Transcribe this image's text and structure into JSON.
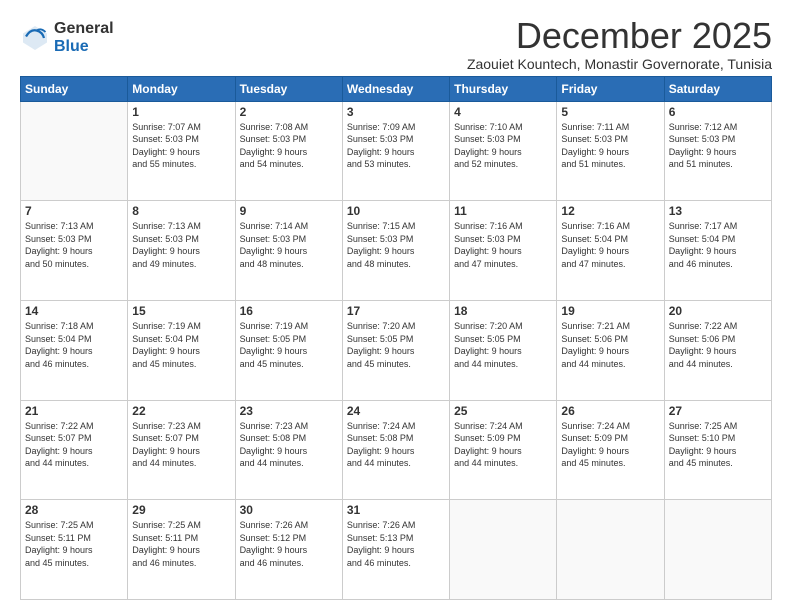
{
  "logo": {
    "general": "General",
    "blue": "Blue"
  },
  "header": {
    "title": "December 2025",
    "subtitle": "Zaouiet Kountech, Monastir Governorate, Tunisia"
  },
  "weekdays": [
    "Sunday",
    "Monday",
    "Tuesday",
    "Wednesday",
    "Thursday",
    "Friday",
    "Saturday"
  ],
  "weeks": [
    [
      {
        "day": "",
        "sunrise": "",
        "sunset": "",
        "daylight": ""
      },
      {
        "day": "1",
        "sunrise": "Sunrise: 7:07 AM",
        "sunset": "Sunset: 5:03 PM",
        "daylight": "Daylight: 9 hours and 55 minutes."
      },
      {
        "day": "2",
        "sunrise": "Sunrise: 7:08 AM",
        "sunset": "Sunset: 5:03 PM",
        "daylight": "Daylight: 9 hours and 54 minutes."
      },
      {
        "day": "3",
        "sunrise": "Sunrise: 7:09 AM",
        "sunset": "Sunset: 5:03 PM",
        "daylight": "Daylight: 9 hours and 53 minutes."
      },
      {
        "day": "4",
        "sunrise": "Sunrise: 7:10 AM",
        "sunset": "Sunset: 5:03 PM",
        "daylight": "Daylight: 9 hours and 52 minutes."
      },
      {
        "day": "5",
        "sunrise": "Sunrise: 7:11 AM",
        "sunset": "Sunset: 5:03 PM",
        "daylight": "Daylight: 9 hours and 51 minutes."
      },
      {
        "day": "6",
        "sunrise": "Sunrise: 7:12 AM",
        "sunset": "Sunset: 5:03 PM",
        "daylight": "Daylight: 9 hours and 51 minutes."
      }
    ],
    [
      {
        "day": "7",
        "sunrise": "Sunrise: 7:13 AM",
        "sunset": "Sunset: 5:03 PM",
        "daylight": "Daylight: 9 hours and 50 minutes."
      },
      {
        "day": "8",
        "sunrise": "Sunrise: 7:13 AM",
        "sunset": "Sunset: 5:03 PM",
        "daylight": "Daylight: 9 hours and 49 minutes."
      },
      {
        "day": "9",
        "sunrise": "Sunrise: 7:14 AM",
        "sunset": "Sunset: 5:03 PM",
        "daylight": "Daylight: 9 hours and 48 minutes."
      },
      {
        "day": "10",
        "sunrise": "Sunrise: 7:15 AM",
        "sunset": "Sunset: 5:03 PM",
        "daylight": "Daylight: 9 hours and 48 minutes."
      },
      {
        "day": "11",
        "sunrise": "Sunrise: 7:16 AM",
        "sunset": "Sunset: 5:03 PM",
        "daylight": "Daylight: 9 hours and 47 minutes."
      },
      {
        "day": "12",
        "sunrise": "Sunrise: 7:16 AM",
        "sunset": "Sunset: 5:04 PM",
        "daylight": "Daylight: 9 hours and 47 minutes."
      },
      {
        "day": "13",
        "sunrise": "Sunrise: 7:17 AM",
        "sunset": "Sunset: 5:04 PM",
        "daylight": "Daylight: 9 hours and 46 minutes."
      }
    ],
    [
      {
        "day": "14",
        "sunrise": "Sunrise: 7:18 AM",
        "sunset": "Sunset: 5:04 PM",
        "daylight": "Daylight: 9 hours and 46 minutes."
      },
      {
        "day": "15",
        "sunrise": "Sunrise: 7:19 AM",
        "sunset": "Sunset: 5:04 PM",
        "daylight": "Daylight: 9 hours and 45 minutes."
      },
      {
        "day": "16",
        "sunrise": "Sunrise: 7:19 AM",
        "sunset": "Sunset: 5:05 PM",
        "daylight": "Daylight: 9 hours and 45 minutes."
      },
      {
        "day": "17",
        "sunrise": "Sunrise: 7:20 AM",
        "sunset": "Sunset: 5:05 PM",
        "daylight": "Daylight: 9 hours and 45 minutes."
      },
      {
        "day": "18",
        "sunrise": "Sunrise: 7:20 AM",
        "sunset": "Sunset: 5:05 PM",
        "daylight": "Daylight: 9 hours and 44 minutes."
      },
      {
        "day": "19",
        "sunrise": "Sunrise: 7:21 AM",
        "sunset": "Sunset: 5:06 PM",
        "daylight": "Daylight: 9 hours and 44 minutes."
      },
      {
        "day": "20",
        "sunrise": "Sunrise: 7:22 AM",
        "sunset": "Sunset: 5:06 PM",
        "daylight": "Daylight: 9 hours and 44 minutes."
      }
    ],
    [
      {
        "day": "21",
        "sunrise": "Sunrise: 7:22 AM",
        "sunset": "Sunset: 5:07 PM",
        "daylight": "Daylight: 9 hours and 44 minutes."
      },
      {
        "day": "22",
        "sunrise": "Sunrise: 7:23 AM",
        "sunset": "Sunset: 5:07 PM",
        "daylight": "Daylight: 9 hours and 44 minutes."
      },
      {
        "day": "23",
        "sunrise": "Sunrise: 7:23 AM",
        "sunset": "Sunset: 5:08 PM",
        "daylight": "Daylight: 9 hours and 44 minutes."
      },
      {
        "day": "24",
        "sunrise": "Sunrise: 7:24 AM",
        "sunset": "Sunset: 5:08 PM",
        "daylight": "Daylight: 9 hours and 44 minutes."
      },
      {
        "day": "25",
        "sunrise": "Sunrise: 7:24 AM",
        "sunset": "Sunset: 5:09 PM",
        "daylight": "Daylight: 9 hours and 44 minutes."
      },
      {
        "day": "26",
        "sunrise": "Sunrise: 7:24 AM",
        "sunset": "Sunset: 5:09 PM",
        "daylight": "Daylight: 9 hours and 45 minutes."
      },
      {
        "day": "27",
        "sunrise": "Sunrise: 7:25 AM",
        "sunset": "Sunset: 5:10 PM",
        "daylight": "Daylight: 9 hours and 45 minutes."
      }
    ],
    [
      {
        "day": "28",
        "sunrise": "Sunrise: 7:25 AM",
        "sunset": "Sunset: 5:11 PM",
        "daylight": "Daylight: 9 hours and 45 minutes."
      },
      {
        "day": "29",
        "sunrise": "Sunrise: 7:25 AM",
        "sunset": "Sunset: 5:11 PM",
        "daylight": "Daylight: 9 hours and 46 minutes."
      },
      {
        "day": "30",
        "sunrise": "Sunrise: 7:26 AM",
        "sunset": "Sunset: 5:12 PM",
        "daylight": "Daylight: 9 hours and 46 minutes."
      },
      {
        "day": "31",
        "sunrise": "Sunrise: 7:26 AM",
        "sunset": "Sunset: 5:13 PM",
        "daylight": "Daylight: 9 hours and 46 minutes."
      },
      {
        "day": "",
        "sunrise": "",
        "sunset": "",
        "daylight": ""
      },
      {
        "day": "",
        "sunrise": "",
        "sunset": "",
        "daylight": ""
      },
      {
        "day": "",
        "sunrise": "",
        "sunset": "",
        "daylight": ""
      }
    ]
  ]
}
